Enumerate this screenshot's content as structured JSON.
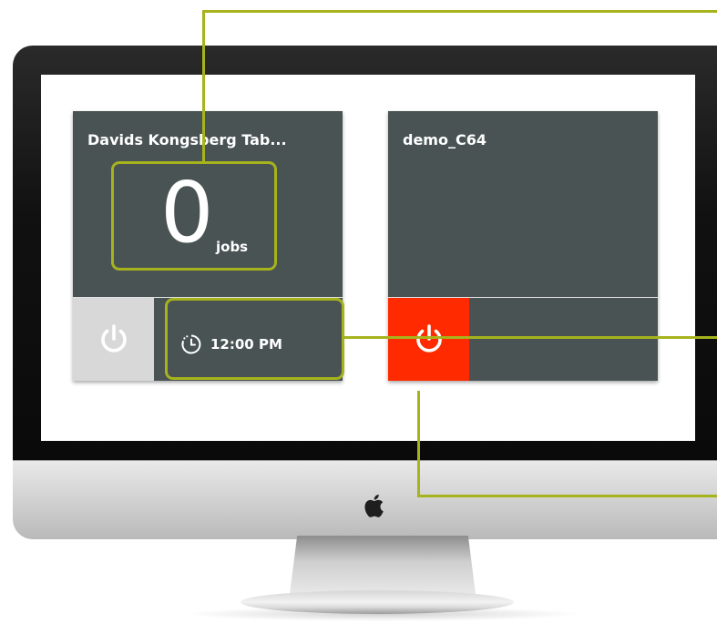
{
  "tiles": [
    {
      "name": "Davids Kongsberg Tab...",
      "jobs_count": "0",
      "jobs_label": "jobs",
      "power_state": "idle",
      "schedule_time": "12:00 PM"
    },
    {
      "name": "demo_C64",
      "power_state": "alert"
    }
  ],
  "colors": {
    "tile_bg": "#495353",
    "power_idle_bg": "#d8d8d8",
    "power_alert_bg": "#ff2a00",
    "callout": "#a6b31c"
  },
  "icons": [
    "power-icon",
    "clock-icon",
    "apple-logo"
  ]
}
